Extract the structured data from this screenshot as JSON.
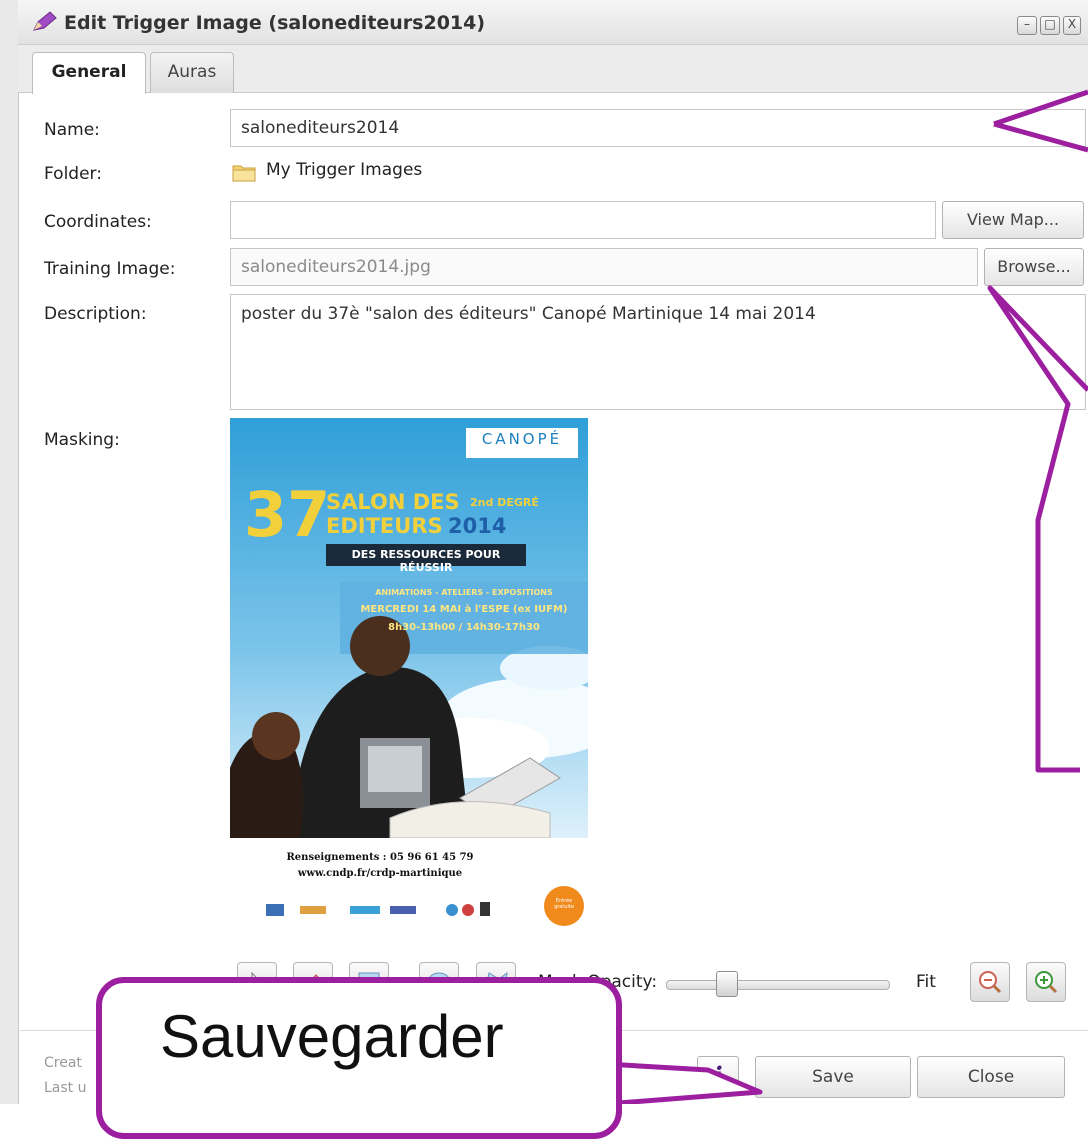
{
  "window": {
    "title": "Edit Trigger Image (salonediteurs2014)",
    "minimize_glyph": "–",
    "maximize_glyph": "□",
    "close_glyph": "X"
  },
  "tabs": [
    {
      "label": "General",
      "active": true
    },
    {
      "label": "Auras",
      "active": false
    }
  ],
  "form": {
    "name_label": "Name:",
    "name_value": "salonediteurs2014",
    "folder_label": "Folder:",
    "folder_value": "My Trigger Images",
    "coordinates_label": "Coordinates:",
    "coordinates_value": "",
    "view_map_label": "View Map...",
    "training_label": "Training Image:",
    "training_value": "salonediteurs2014.jpg",
    "browse_label": "Browse...",
    "description_label": "Description:",
    "description_value": "poster du 37è \"salon des éditeurs\" Canopé Martinique 14 mai 2014",
    "masking_label": "Masking:"
  },
  "poster": {
    "brand": "CANOPÉ",
    "number": "37",
    "line1": "SALON DES",
    "line1_tag": "2nd DEGRÉ",
    "line2a": "EDITEURS",
    "line2b": "2014",
    "banner": "DES RESSOURCES POUR RÉUSSIR",
    "events": "ANIMATIONS - ATELIERS - EXPOSITIONS",
    "date": "MERCREDI 14 MAI à l'ESPE (ex IUFM)",
    "hours": "8h30-13h00 / 14h30-17h30",
    "contact": "Renseignements : 05 96 61 45 79",
    "website": "www.cndp.fr/crdp-martinique",
    "entry_badge": "Entrée gratuite"
  },
  "mask_toolbar": {
    "opacity_label": "Mask Opacity:",
    "opacity_value": 0.25,
    "fit_label": "Fit",
    "tools": [
      "select-icon",
      "eraser-icon",
      "rectangle-icon",
      "ellipse-icon",
      "polygon-icon"
    ]
  },
  "footer": {
    "created_label": "Creat",
    "updated_label": "Last u",
    "info_glyph": "i",
    "save_label": "Save",
    "close_label": "Close"
  },
  "callout": {
    "text": "Sauvegarder"
  },
  "colors": {
    "annotation": "#9c1fa0",
    "poster_sky": "#3a9fd4",
    "poster_yellow": "#f2d03b"
  }
}
